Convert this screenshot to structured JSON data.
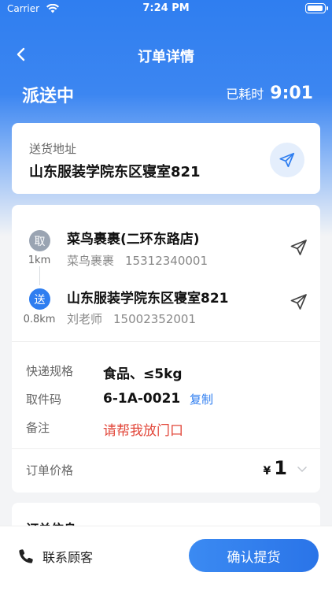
{
  "status_bar": {
    "carrier": "Carrier",
    "time": "7:24 PM"
  },
  "nav": {
    "title": "订单详情"
  },
  "status": {
    "text": "派送中",
    "elapsed_label": "已耗时",
    "elapsed_time": "9:01"
  },
  "delivery_address": {
    "label": "送货地址",
    "value": "山东服装学院东区寝室821"
  },
  "route": {
    "pickup": {
      "badge": "取",
      "distance": "1km",
      "name": "菜鸟裹裹(二环东路店)",
      "contact_name": "菜鸟裹裹",
      "phone": "15312340001"
    },
    "dropoff": {
      "badge": "送",
      "distance": "0.8km",
      "name": "山东服装学院东区寝室821",
      "contact_name": "刘老师",
      "phone": "15002352001"
    }
  },
  "info": {
    "spec_label": "快递规格",
    "spec_value": "食品、≤5kg",
    "code_label": "取件码",
    "code_value": "6-1A-0021",
    "copy_label": "复制",
    "note_label": "备注",
    "note_value": "请帮我放门口"
  },
  "price": {
    "label": "订单价格",
    "currency": "¥",
    "amount": "1"
  },
  "order_info": {
    "title": "订单信息"
  },
  "bottom": {
    "contact_label": "联系顾客",
    "confirm_label": "确认提货"
  },
  "colors": {
    "primary": "#2f7ef0",
    "accent_red": "#e2473a",
    "badge_gray": "#9aa4b2"
  }
}
